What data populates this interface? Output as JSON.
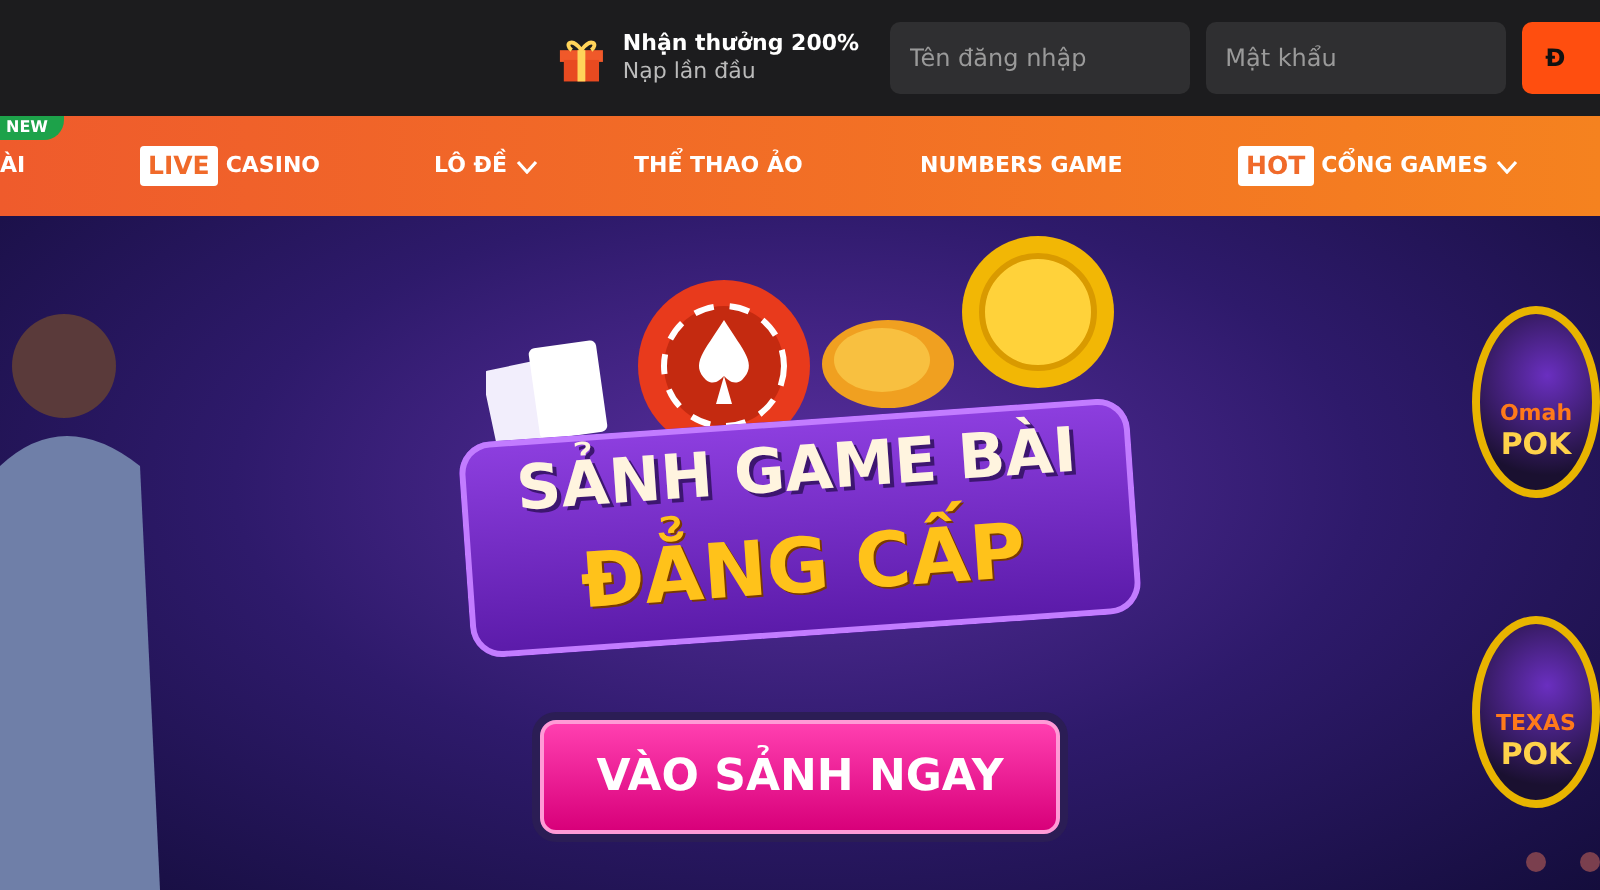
{
  "topbar": {
    "promo": {
      "title": "Nhận thưởng 200%",
      "subtitle": "Nạp lần đầu"
    },
    "username": {
      "placeholder": "Tên đăng nhập"
    },
    "password": {
      "placeholder": "Mật khẩu"
    },
    "login_button": "Đ"
  },
  "nav": {
    "new_badge": "NEW",
    "items": [
      {
        "label": "ÀI",
        "dropdown": false
      },
      {
        "tag": "LIVE",
        "label": "CASINO",
        "dropdown": false
      },
      {
        "label": "LÔ ĐỀ",
        "dropdown": true
      },
      {
        "label": "THỂ THAO ẢO",
        "dropdown": false
      },
      {
        "label": "NUMBERS GAME",
        "dropdown": false
      },
      {
        "tag": "HOT",
        "label": "CỔNG GAMES",
        "dropdown": true
      }
    ]
  },
  "banner": {
    "title_line_1": "SẢNH GAME BÀI",
    "title_line_2": "ĐẲNG CẤP",
    "cta": "VÀO SẢNH NGAY",
    "games": [
      {
        "line_1": "Omah",
        "line_2": "POK"
      },
      {
        "line_1": "TEXAS",
        "line_2": "POK"
      }
    ]
  }
}
